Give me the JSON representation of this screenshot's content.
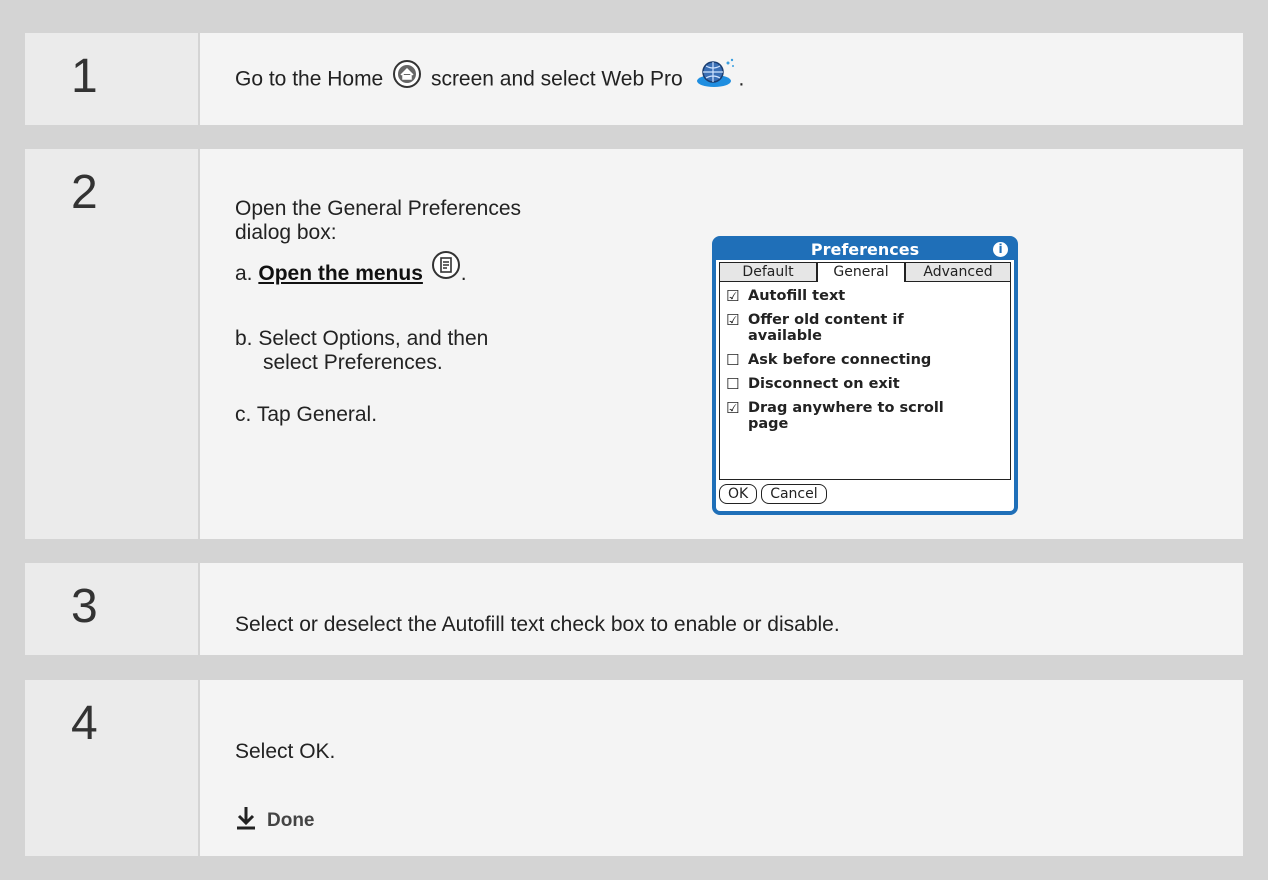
{
  "steps": [
    {
      "number": "1",
      "text_before_home": "Go to the Home",
      "text_after_home": "screen and select Web Pro",
      "text_end": "."
    },
    {
      "number": "2",
      "intro_line1": "Open the General Preferences",
      "intro_line2": "dialog box:",
      "a_prefix": "a.",
      "a_link": "Open the menus",
      "a_end": ".",
      "b_prefix": "b.",
      "b_line1": "Select Options, and then",
      "b_line2": "select Preferences.",
      "c_prefix": "c.",
      "c_text": "Tap General."
    },
    {
      "number": "3",
      "text": "Select or deselect the Autofill text check box to enable or disable."
    },
    {
      "number": "4",
      "text": "Select OK.",
      "done_label": "Done"
    }
  ],
  "dialog": {
    "title": "Preferences",
    "info_glyph": "i",
    "tabs": [
      "Default",
      "General",
      "Advanced"
    ],
    "active_tab": "General",
    "options": [
      {
        "line1": "Autofill text",
        "line2": "",
        "checked": true,
        "mark": "☑"
      },
      {
        "line1": "Offer old content if",
        "line2": "available",
        "checked": true,
        "mark": "☑"
      },
      {
        "line1": "Ask before connecting",
        "line2": "",
        "checked": false,
        "mark": "☐"
      },
      {
        "line1": "Disconnect on exit",
        "line2": "",
        "checked": false,
        "mark": "☐"
      },
      {
        "line1": "Drag anywhere to scroll",
        "line2": "page",
        "checked": true,
        "mark": "☑"
      }
    ],
    "buttons": [
      "OK",
      "Cancel"
    ]
  },
  "icons": {
    "home": "home-icon",
    "webpro": "web-pro-globe-icon",
    "menu": "menu-icon",
    "done": "down-arrow-icon"
  },
  "colors": {
    "dialog_blue": "#1f6fb8",
    "number_bg": "#ebebeb",
    "content_bg": "#f4f4f4",
    "page_bg": "#d4d4d4"
  }
}
